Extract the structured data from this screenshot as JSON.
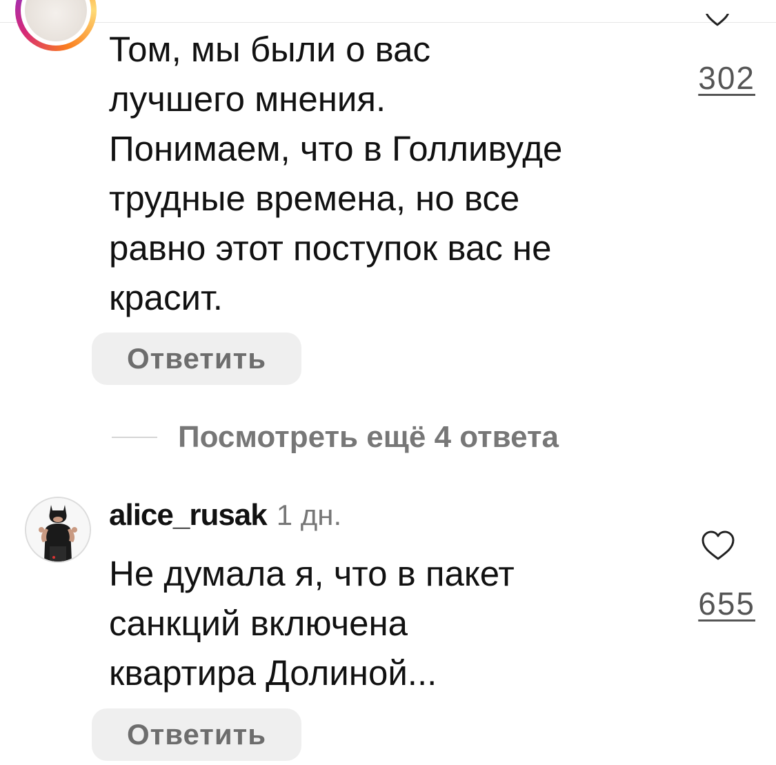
{
  "comments": [
    {
      "text": "Том, мы были о вас\nлучшего мнения.\nПонимаем, что в Голливуде\nтрудные времена, но все\nравно этот поступок вас не\nкрасит.",
      "likes": "302",
      "reply_label": "Ответить"
    },
    {
      "username": "alice_rusak",
      "time": "1 дн.",
      "text": "Не думала я, что в пакет\nсанкций включена\nквартира Долиной...",
      "likes": "655",
      "reply_label": "Ответить"
    }
  ],
  "more_replies_label": "Посмотреть ещё 4 ответа",
  "colors": {
    "text": "#111111",
    "muted": "#777777",
    "reply_bg": "#efefef",
    "story_ring": [
      "#feda75",
      "#fa7e1e",
      "#d62976",
      "#962fbf"
    ]
  },
  "icons": {
    "like": "heart-outline-icon"
  }
}
